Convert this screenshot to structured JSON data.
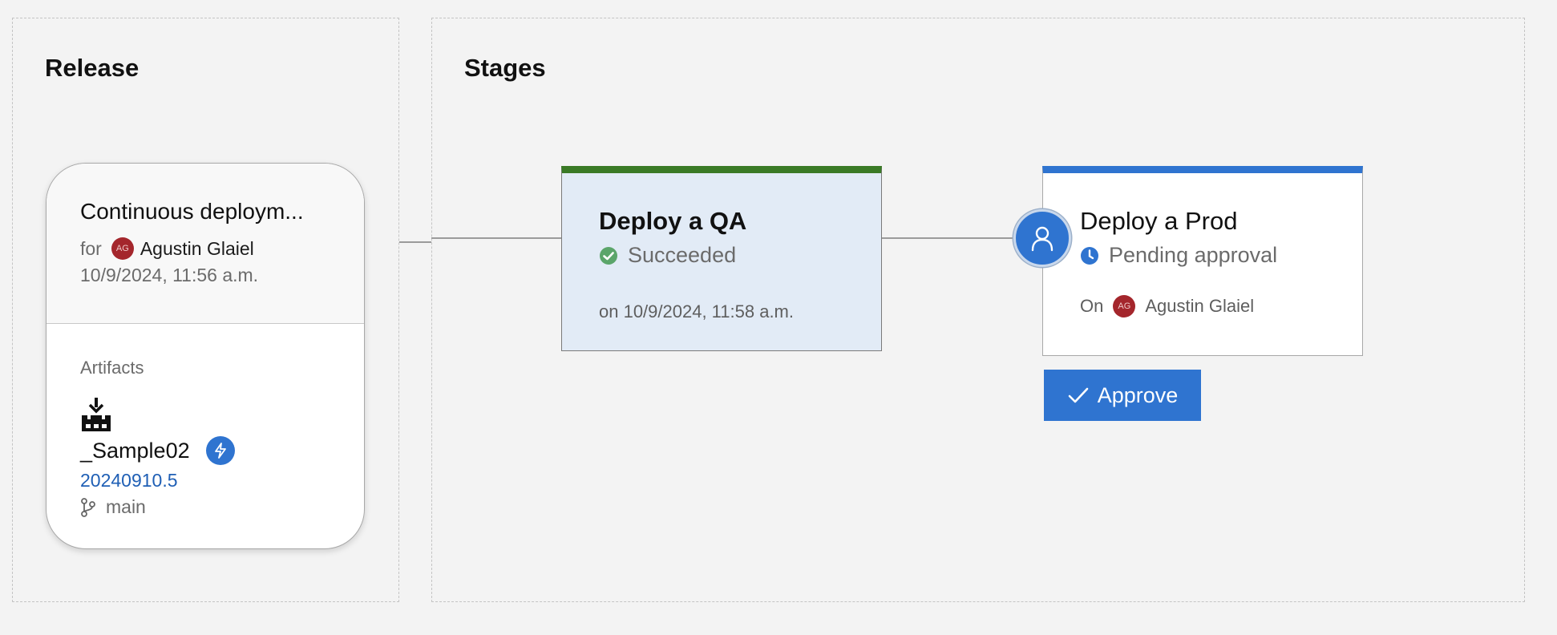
{
  "release_panel": {
    "title": "Release",
    "card": {
      "name": "Continuous deploym...",
      "for_label": "for",
      "avatar_initials": "AG",
      "requested_by": "Agustin Glaiel",
      "created": "10/9/2024, 11:56 a.m.",
      "artifacts_label": "Artifacts",
      "artifact": {
        "name": "_Sample02",
        "build": "20240910.5",
        "branch": "main",
        "icon": "build-artifact-icon",
        "trigger_icon": "lightning-icon"
      }
    }
  },
  "stages_panel": {
    "title": "Stages",
    "stages": [
      {
        "name": "Deploy a QA",
        "status": "Succeeded",
        "status_icon": "check-circle-icon",
        "detail": "on 10/9/2024, 11:58 a.m.",
        "accent": "#3a7a26"
      },
      {
        "name": "Deploy a Prod",
        "status": "Pending approval",
        "status_icon": "clock-icon",
        "on_label": "On",
        "avatar_initials": "AG",
        "approver": "Agustin Glaiel",
        "accent": "#2f74d0"
      }
    ],
    "approve_button": "Approve"
  },
  "colors": {
    "brand_blue": "#2f74d0",
    "success_green": "#3a7a26",
    "avatar_red": "#a4262c"
  }
}
